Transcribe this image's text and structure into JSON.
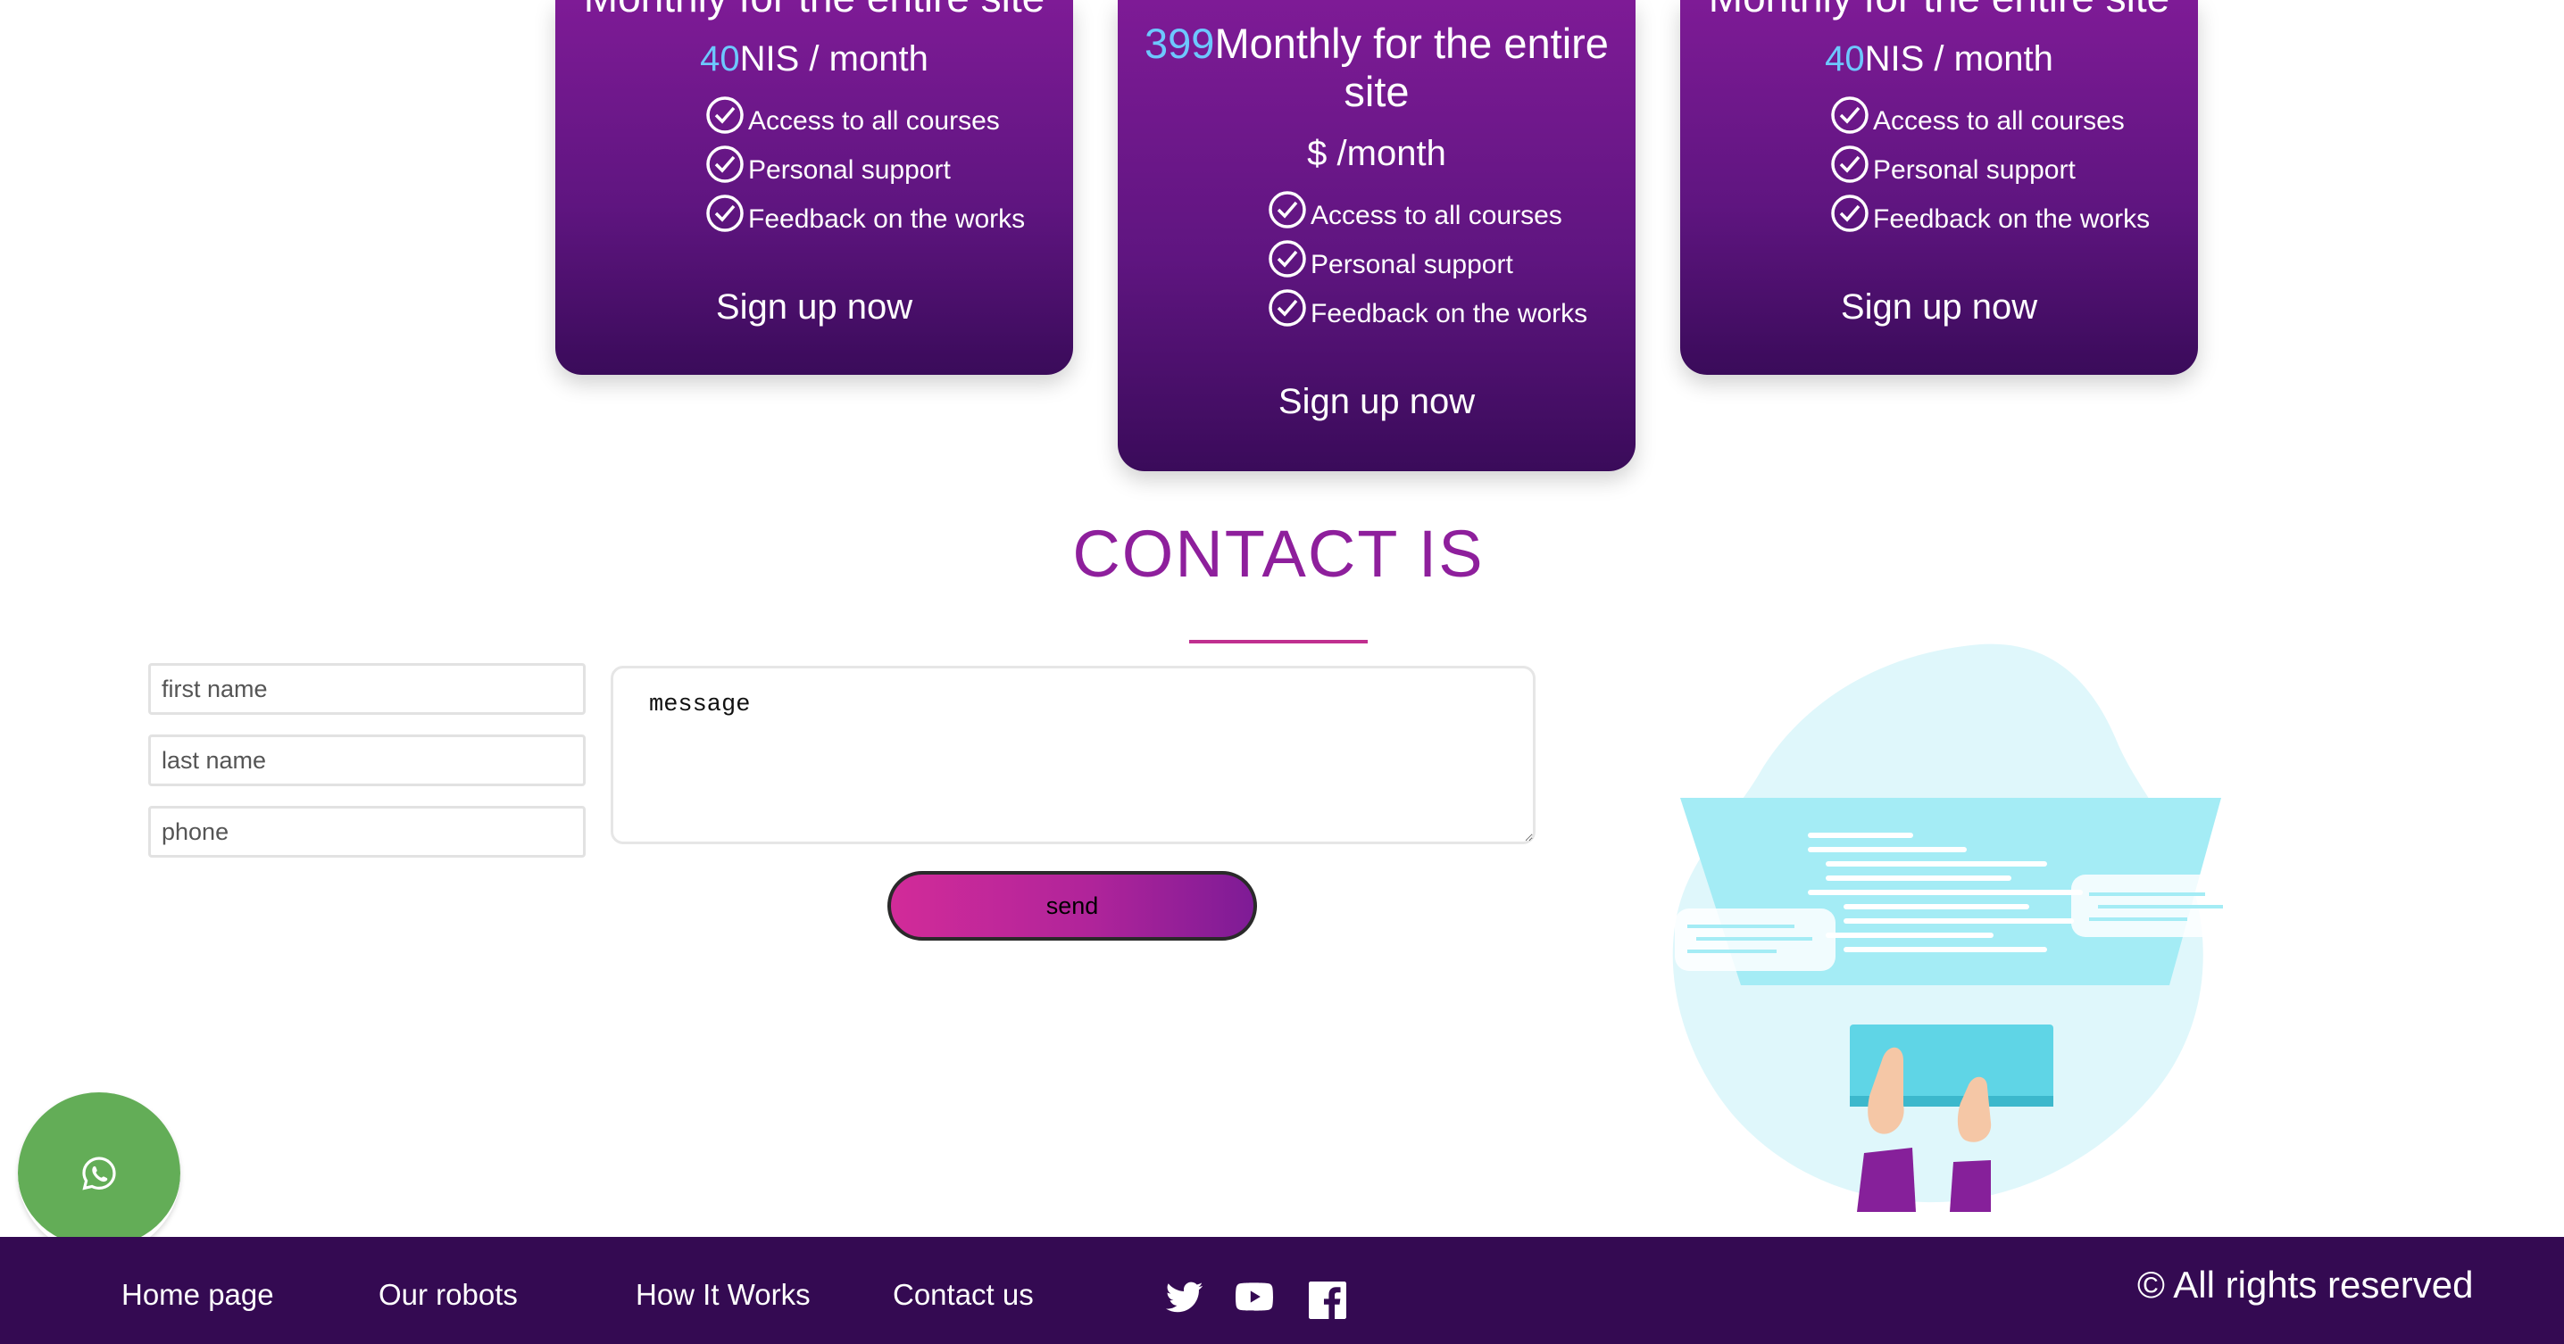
{
  "pricing": {
    "left": {
      "title": "Monthly for the entire site",
      "price_number": "40",
      "price_suffix": "NIS / month",
      "features": [
        "Access to all courses",
        "Personal support",
        "Feedback on the works"
      ],
      "cta": "Sign up now"
    },
    "middle": {
      "price_number": "399",
      "title": "Monthly for the entire site",
      "price_suffix": "$ /month",
      "features": [
        "Access to all courses",
        "Personal support",
        "Feedback on the works"
      ],
      "cta": "Sign up now"
    },
    "right": {
      "title": "Monthly for the entire site",
      "price_number": "40",
      "price_suffix": "NIS / month",
      "features": [
        "Access to all courses",
        "Personal support",
        "Feedback on the works"
      ],
      "cta": "Sign up now"
    }
  },
  "contact": {
    "heading": "CONTACT IS",
    "first_name_placeholder": "first name",
    "last_name_placeholder": "last name",
    "phone_placeholder": "phone",
    "message_placeholder": "message",
    "send_label": "send"
  },
  "footer": {
    "nav": [
      "Home page",
      "Our robots",
      "How It Works",
      "Contact us"
    ],
    "social_icons": [
      "twitter-icon",
      "youtube-icon",
      "facebook-icon"
    ],
    "copyright": "© All rights reserved"
  },
  "colors": {
    "card_gradient_top": "#7e1b96",
    "card_gradient_bottom": "#3a0b5a",
    "price_accent": "#6dc8ff",
    "heading": "#8e1f9c",
    "footer_bg": "#340a52",
    "whatsapp": "#63ad57"
  }
}
